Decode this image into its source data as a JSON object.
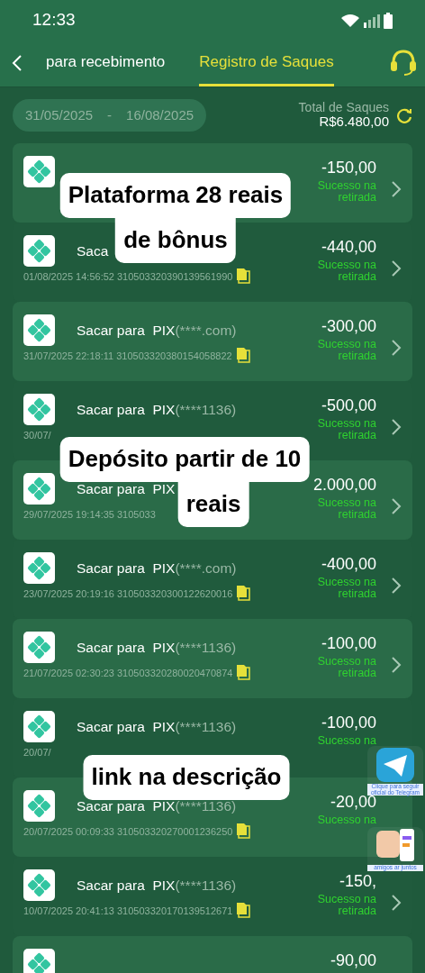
{
  "status_bar": {
    "time": "12:33"
  },
  "header": {
    "tabs": [
      {
        "label": "para recebimento",
        "selected": false
      },
      {
        "label": "Registro de Saques",
        "selected": true
      }
    ]
  },
  "filter": {
    "date_from": "31/05/2025",
    "separator": "-",
    "date_to": "16/08/2025",
    "total_label": "Total de Saques",
    "total": "R$6.480,00"
  },
  "rows": [
    {
      "amount": "-150,00",
      "status": "Sucesso na retirada",
      "copy": false,
      "chevron": true
    },
    {
      "title": "Saca",
      "date_id": "01/08/2025 14:56:52 310503320390139561990",
      "amount": "-440,00",
      "status": "Sucesso na retirada",
      "copy": true,
      "chevron": true
    },
    {
      "title": "Sacar para  PIX",
      "account": "(****.com)",
      "date_id": "31/07/2025 22:18:11 310503320380154058822",
      "amount": "-300,00",
      "status": "Sucesso na retirada",
      "copy": true,
      "chevron": true
    },
    {
      "title": "Sacar para  PIX",
      "account": "(****1136)",
      "date_id": "30/07/",
      "amount": "-500,00",
      "status": "Sucesso na retirada",
      "copy": false,
      "chevron": true
    },
    {
      "title": "Sacar para  PIX",
      "date_id": "29/07/2025 19:14:35 3105033",
      "amount": "2.000,00",
      "status": "Sucesso na retirada",
      "copy": false,
      "chevron": true
    },
    {
      "title": "Sacar para  PIX",
      "account": "(****.com)",
      "date_id": "23/07/2025 20:19:16 310503320300122620016",
      "amount": "-400,00",
      "status": "Sucesso na retirada",
      "copy": true,
      "chevron": true
    },
    {
      "title": "Sacar para  PIX",
      "account": "(****1136)",
      "date_id": "21/07/2025 02:30:23 310503320280020470874",
      "amount": "-100,00",
      "status": "Sucesso na retirada",
      "copy": true,
      "chevron": true
    },
    {
      "title": "Sacar para  PIX",
      "account": "(****1136)",
      "date_id": "20/07/",
      "amount": "-100,00",
      "status": "Sucesso na",
      "copy": false,
      "chevron": false
    },
    {
      "title": "Sacar para  PIX",
      "account": "(****1136)",
      "date_id": "20/07/2025 00:09:33 310503320270001236250",
      "amount": "-20,00",
      "status": "Sucesso na",
      "copy": true,
      "chevron": false
    },
    {
      "title": "Sacar para  PIX",
      "account": "(****1136)",
      "date_id": "10/07/2025 20:41:13 310503320170139512671",
      "amount": "-150,",
      "status": "Sucesso na retirada",
      "copy": true,
      "chevron": true
    },
    {
      "amount": "-90,00",
      "copy": false,
      "chevron": false
    }
  ],
  "captions": [
    {
      "lines": [
        "Plataforma 28 reais",
        "de bônus"
      ]
    },
    {
      "lines": [
        "Depósito partir de 10",
        "reais"
      ]
    },
    {
      "lines": [
        "link na descrição"
      ]
    }
  ],
  "widgets": [
    {
      "kind": "telegram",
      "label": "Clique para seguir oficial do Telegram"
    },
    {
      "kind": "invite",
      "label": "amigos ar juntos"
    }
  ]
}
